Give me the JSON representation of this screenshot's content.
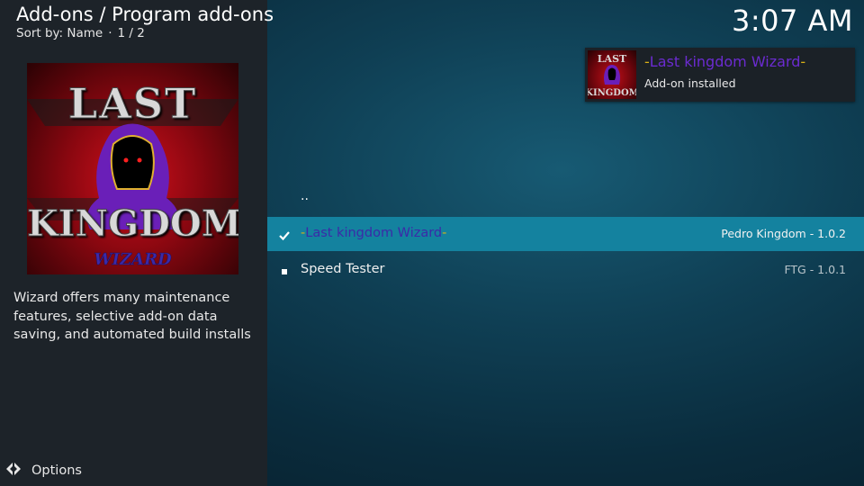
{
  "header": {
    "title": "Add-ons / Program add-ons",
    "sort_label": "Sort by: Name",
    "page": "1 / 2",
    "clock": "3:07 AM"
  },
  "selected_addon": {
    "poster_text": [
      "LAST",
      "KINGDOM",
      "WIZARD"
    ],
    "description": "Wizard offers many maintenance features, selective add-on data saving, and automated build installs"
  },
  "footer": {
    "options_label": "Options"
  },
  "notification": {
    "dash_left": "-",
    "title": "Last kingdom Wizard",
    "dash_right": "-",
    "subtitle": "Add-on installed",
    "thumb_text": [
      "LAST",
      "KINGDOM"
    ]
  },
  "list": {
    "parent": "..",
    "items": [
      {
        "dash_left": "-",
        "name": "Last kingdom Wizard",
        "dash_right": "-",
        "author_version": "Pedro Kingdom - 1.0.2",
        "status": "enabled"
      },
      {
        "name": "Speed Tester",
        "author_version": "FTG - 1.0.1",
        "status": "installed"
      }
    ]
  },
  "colors": {
    "highlight": "#14829f",
    "left_panel": "#1d2329",
    "addon_name_purple": "#3b2aa8",
    "dash_yellow": "#d8b016"
  },
  "icons": {
    "check": "check-icon",
    "bullet": "square-bullet-icon",
    "options": "options-icon"
  }
}
